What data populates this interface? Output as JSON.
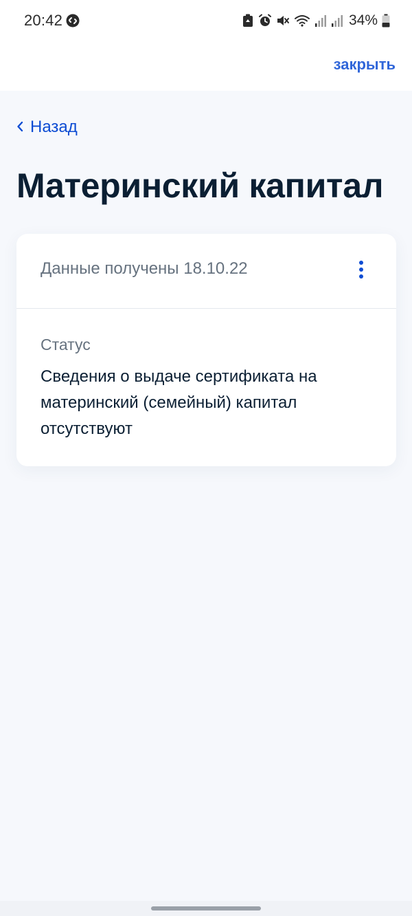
{
  "status_bar": {
    "time": "20:42",
    "battery": "34%",
    "icons": [
      "shazam-icon",
      "recycle-icon",
      "alarm-icon",
      "mute-icon",
      "wifi-icon",
      "signal-icon",
      "signal-icon",
      "battery-icon"
    ]
  },
  "top_bar": {
    "close_label": "закрыть"
  },
  "navigation": {
    "back_label": "Назад"
  },
  "page": {
    "title": "Материнский капитал"
  },
  "card": {
    "received_label": "Данные получены 18.10.22",
    "status_label": "Статус",
    "status_value": "Сведения о выдаче сертификата на материнский (семейный) капитал отсутствуют"
  },
  "colors": {
    "accent": "#0d4cd3",
    "title": "#0b1f33",
    "secondary_text": "#66727f",
    "background": "#f6f8fc"
  }
}
